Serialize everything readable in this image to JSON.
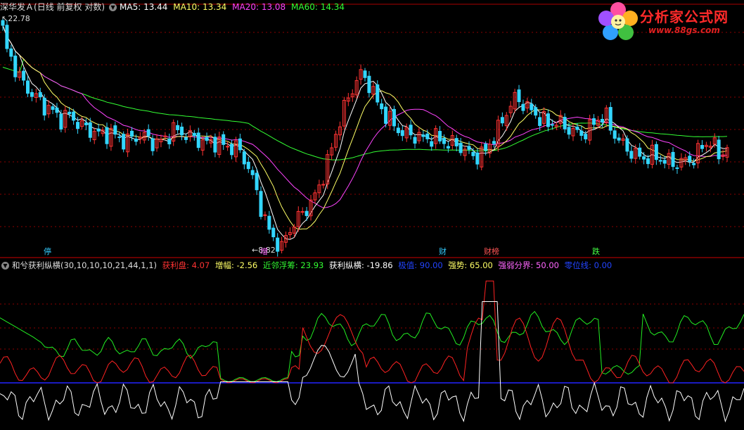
{
  "header_main": {
    "stock_name": "深华发Ａ",
    "period": "(日线 前复权 对数)",
    "ma5": "MA5: 13.44",
    "ma10": "MA10: 13.34",
    "ma20": "MA20: 13.08",
    "ma60": "MA60: 14.34"
  },
  "colors": {
    "ma5": "#ffffff",
    "ma10": "#ffff66",
    "ma20": "#ff44ff",
    "ma60": "#33ff33",
    "up": "#ff3333",
    "down": "#33d6ff",
    "grid": "#8b0000",
    "zero_line": "#2222ff",
    "indicator_red": "#ff2222",
    "indicator_green": "#22ee22",
    "indicator_white": "#ffffff"
  },
  "price_labels": {
    "high": "22.78",
    "low": "8.82"
  },
  "events": [
    {
      "label": "停",
      "color": "#33ccff"
    },
    {
      "label": "增",
      "color": "#ff66ff"
    },
    {
      "label": "财",
      "color": "#33ccff"
    },
    {
      "label": "财榜",
      "color": "#ff5555"
    },
    {
      "label": "跌",
      "color": "#44ff44"
    }
  ],
  "header_indicator": {
    "name": "和兮获利纵横(30,10,10,10,21,44,1,1)",
    "profit_label": "获利盘: 4.07",
    "increase_label": "增幅: -2.56",
    "float_label": "近邻浮筹: 23.93",
    "vertical_label": "获利纵横: -19.86",
    "peak_label": "极值: 90.00",
    "strength_label": "强势: 65.00",
    "boundary_label": "强弱分界: 50.00",
    "zero_label": "零位线: 0.00"
  },
  "logo": {
    "title": "分析家公式网",
    "url": "www.88gs.com"
  },
  "chart_data": [
    {
      "type": "candlestick",
      "title": "深华发Ａ",
      "y_scale": "log",
      "y_range": [
        8.82,
        22.78
      ],
      "series": [
        {
          "name": "MA5",
          "value": 13.44
        },
        {
          "name": "MA10",
          "value": 13.34
        },
        {
          "name": "MA20",
          "value": 13.08
        },
        {
          "name": "MA60",
          "value": 14.34
        }
      ],
      "close_approx": [
        20.5,
        19.2,
        17.8,
        16.9,
        16.4,
        15.8,
        15.5,
        14.9,
        15.2,
        14.8,
        14.4,
        14.2,
        14.0,
        14.1,
        13.9,
        13.6,
        13.8,
        14.0,
        13.7,
        13.5,
        13.8,
        14.3,
        14.1,
        13.9,
        13.7,
        13.5,
        13.6,
        13.4,
        13.3,
        13.2,
        12.4,
        11.3,
        10.0,
        9.2,
        8.9,
        9.3,
        9.8,
        10.2,
        10.6,
        11.4,
        12.6,
        14.2,
        15.7,
        17.0,
        18.0,
        17.3,
        16.0,
        15.2,
        14.6,
        14.1,
        14.0,
        13.9,
        13.7,
        13.9,
        13.6,
        13.5,
        13.4,
        13.0,
        12.8,
        12.9,
        13.6,
        14.4,
        15.5,
        16.3,
        15.9,
        15.4,
        15.0,
        14.6,
        14.8,
        14.5,
        14.2,
        14.0,
        14.3,
        14.9,
        15.2,
        14.1,
        13.5,
        13.1,
        12.8,
        12.7,
        12.9,
        12.6,
        12.5,
        12.4,
        12.6,
        12.7,
        13.4,
        13.6,
        12.9,
        13.2
      ],
      "indicator": {
        "name": "和兮获利纵横",
        "profit": 4.07,
        "increase": -2.56,
        "near_float": 23.93,
        "vertical": -19.86,
        "reference_lines": [
          {
            "name": "极值",
            "value": 90.0
          },
          {
            "name": "强势",
            "value": 65.0
          },
          {
            "name": "强弱分界",
            "value": 50.0
          },
          {
            "name": "零位线",
            "value": 0.0
          }
        ]
      }
    }
  ]
}
